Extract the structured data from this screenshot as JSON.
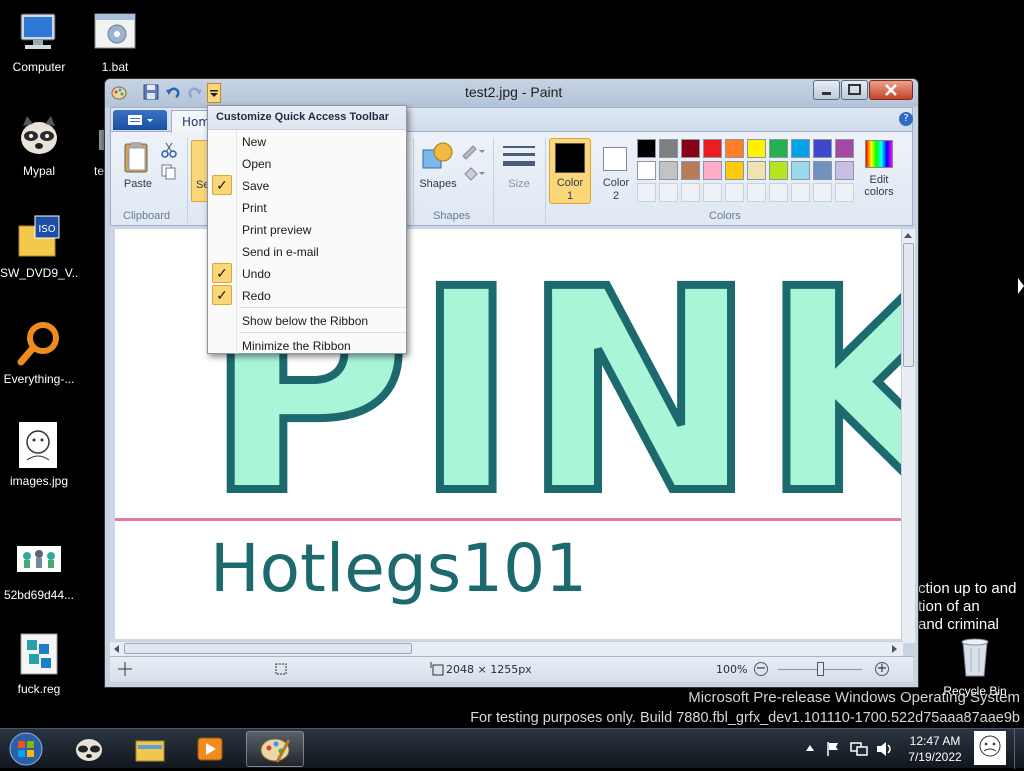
{
  "desktop": {
    "icons": [
      {
        "label": "Computer"
      },
      {
        "label": "1.bat"
      },
      {
        "label": "Mypal"
      },
      {
        "label": "SW_DVD9_V..."
      },
      {
        "label": "Everything-..."
      },
      {
        "label": "images.jpg"
      },
      {
        "label": "52bd69d44..."
      },
      {
        "label": "fuck.reg"
      },
      {
        "label": "Recycle Bin"
      }
    ],
    "partial_icon_label": "tes",
    "partial_text": [
      "ction up to and",
      "tion of an",
      "and criminal"
    ],
    "watermark": {
      "line1": "Microsoft Pre-release Windows Operating System",
      "line2": "For testing purposes only. Build 7880.fbl_grfx_dev1.101110-1700.522d75aaa87aae9b"
    }
  },
  "window": {
    "title": "test2.jpg - Paint",
    "tab_home": "Home",
    "groups": {
      "clipboard": "Clipboard",
      "shapes": "Shapes",
      "colors": "Colors"
    },
    "buttons": {
      "paste": "Paste",
      "select_partial": "Se",
      "shapes": "Shapes",
      "size": "Size",
      "color1_line1": "Color",
      "color1_line2": "1",
      "color2_line1": "Color",
      "color2_line2": "2",
      "edit_colors_line1": "Edit",
      "edit_colors_line2": "colors"
    },
    "palette_row1": [
      "#000000",
      "#7f7f7f",
      "#880015",
      "#ed1c24",
      "#ff7f27",
      "#fff200",
      "#22b14c",
      "#00a2e8",
      "#3f48cc",
      "#a349a4"
    ],
    "palette_row2": [
      "#ffffff",
      "#c3c3c3",
      "#b97a57",
      "#ffaec9",
      "#ffc90e",
      "#efe4b0",
      "#b5e61d",
      "#99d9ea",
      "#7092be",
      "#c8bfe7"
    ],
    "canvas": {
      "big_text": "PINK",
      "sub_text": "Hotlegs101",
      "fill_color": "#a8f5d8",
      "stroke_color": "#1c6a6d",
      "line_color": "#e27aa6"
    },
    "status": {
      "dimensions": "2048 × 1255px",
      "zoom": "100%"
    }
  },
  "qat_menu": {
    "header": "Customize Quick Access Toolbar",
    "items": [
      {
        "label": "New",
        "checked": false
      },
      {
        "label": "Open",
        "checked": false
      },
      {
        "label": "Save",
        "checked": true
      },
      {
        "label": "Print",
        "checked": false
      },
      {
        "label": "Print preview",
        "checked": false
      },
      {
        "label": "Send in e-mail",
        "checked": false
      },
      {
        "label": "Undo",
        "checked": true
      },
      {
        "label": "Redo",
        "checked": true
      },
      {
        "label": "Show below the Ribbon",
        "checked": false
      },
      {
        "label": "Minimize the Ribbon",
        "checked": false
      }
    ]
  },
  "taskbar": {
    "time": "12:47 AM",
    "date": "7/19/2022"
  }
}
